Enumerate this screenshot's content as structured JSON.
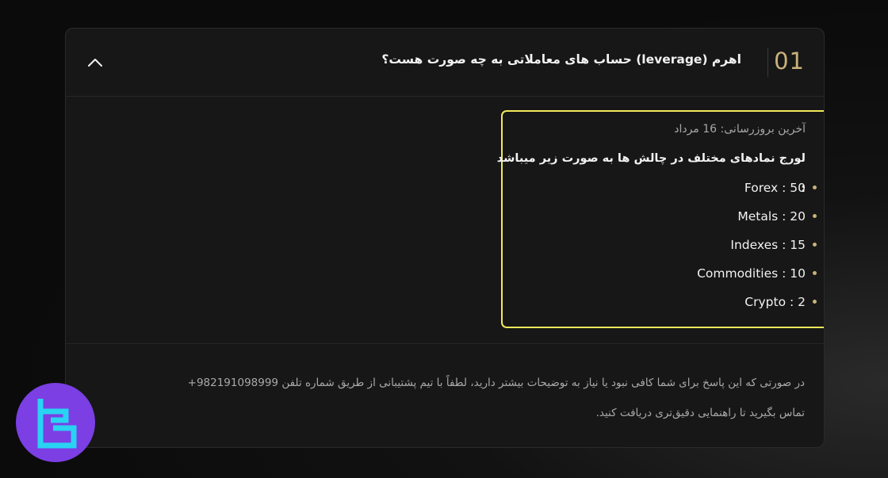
{
  "faq": {
    "number": "01",
    "question": "اهرم (leverage) حساب های معاملاتی به چه صورت هست؟",
    "expanded": true,
    "icons": {
      "toggle": "chevron-up-icon"
    },
    "answer": {
      "updated": "آخرین بروزرسانی: 16 مرداد",
      "intro": "لورج نمادهای مختلف در چالش ها به صورت زیر میباشد :",
      "items": [
        {
          "label": "Forex : 50"
        },
        {
          "label": "Metals : 20"
        },
        {
          "label": "Indexes : 15"
        },
        {
          "label": "Commodities : 10"
        },
        {
          "label": "Crypto : 2"
        }
      ]
    },
    "footer_line1": "در صورتی که این پاسخ برای شما کافی نبود یا نیاز به توضیحات بیشتر دارید، لطفاً با تیم پشتیبانی از طریق شماره تلفن 982191098999+",
    "footer_line2": "تماس بگیرید تا راهنمایی دقیق‌تری دریافت کنید."
  },
  "colors": {
    "accent_gold": "#c9b27a",
    "highlight_yellow": "#f2e95c",
    "logo_purple": "#7b3fe4",
    "logo_cyan": "#29d3f2"
  },
  "logo": {
    "icon": "tradingfinder-logo-icon"
  }
}
